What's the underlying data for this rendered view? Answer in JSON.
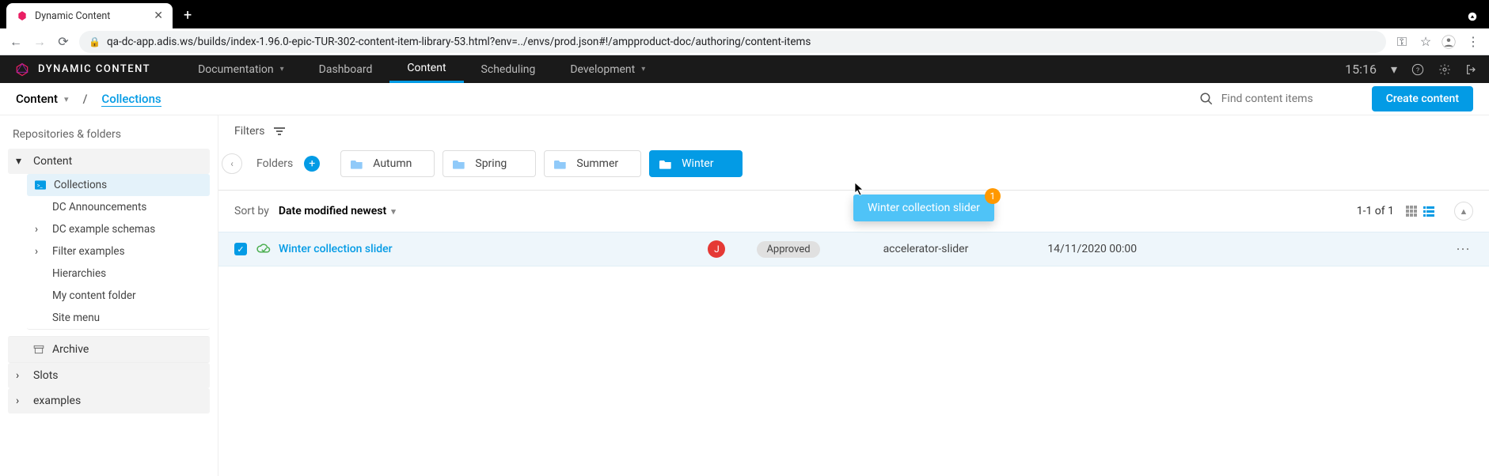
{
  "browser": {
    "tab_title": "Dynamic Content",
    "url": "qa-dc-app.adis.ws/builds/index-1.96.0-epic-TUR-302-content-item-library-53.html?env=../envs/prod.json#!/ampproduct-doc/authoring/content-items"
  },
  "topnav": {
    "logo_text": "DYNAMIC CONTENT",
    "items": [
      {
        "label": "Documentation",
        "dropdown": true
      },
      {
        "label": "Dashboard"
      },
      {
        "label": "Content",
        "active": true
      },
      {
        "label": "Scheduling"
      },
      {
        "label": "Development",
        "dropdown": true
      }
    ],
    "clock": "15:16"
  },
  "breadcrumb": {
    "root": "Content",
    "current": "Collections",
    "search_placeholder": "Find content items",
    "create_button": "Create content"
  },
  "sidebar": {
    "heading": "Repositories & folders",
    "groups": [
      {
        "label": "Content",
        "expanded": true,
        "items": [
          {
            "label": "Collections",
            "active": true,
            "icon": "cmd"
          },
          {
            "label": "DC Announcements"
          },
          {
            "label": "DC example schemas",
            "caret": true
          },
          {
            "label": "Filter examples",
            "caret": true
          },
          {
            "label": "Hierarchies"
          },
          {
            "label": "My content folder"
          },
          {
            "label": "Site menu"
          }
        ]
      },
      {
        "label": "Archive",
        "icon": "archive"
      },
      {
        "label": "Slots",
        "caret": true
      },
      {
        "label": "examples",
        "caret": true
      }
    ]
  },
  "filters": {
    "label": "Filters"
  },
  "folders": {
    "label": "Folders",
    "items": [
      {
        "label": "Autumn"
      },
      {
        "label": "Spring"
      },
      {
        "label": "Summer"
      },
      {
        "label": "Winter",
        "active": true
      }
    ]
  },
  "drag": {
    "label": "Winter collection slider",
    "count": "1"
  },
  "sort": {
    "label": "Sort by",
    "value": "Date modified newest",
    "range": "1-1 of 1"
  },
  "row": {
    "title": "Winter collection slider",
    "avatar": "J",
    "status": "Approved",
    "type": "accelerator-slider",
    "date": "14/11/2020 00:00"
  }
}
